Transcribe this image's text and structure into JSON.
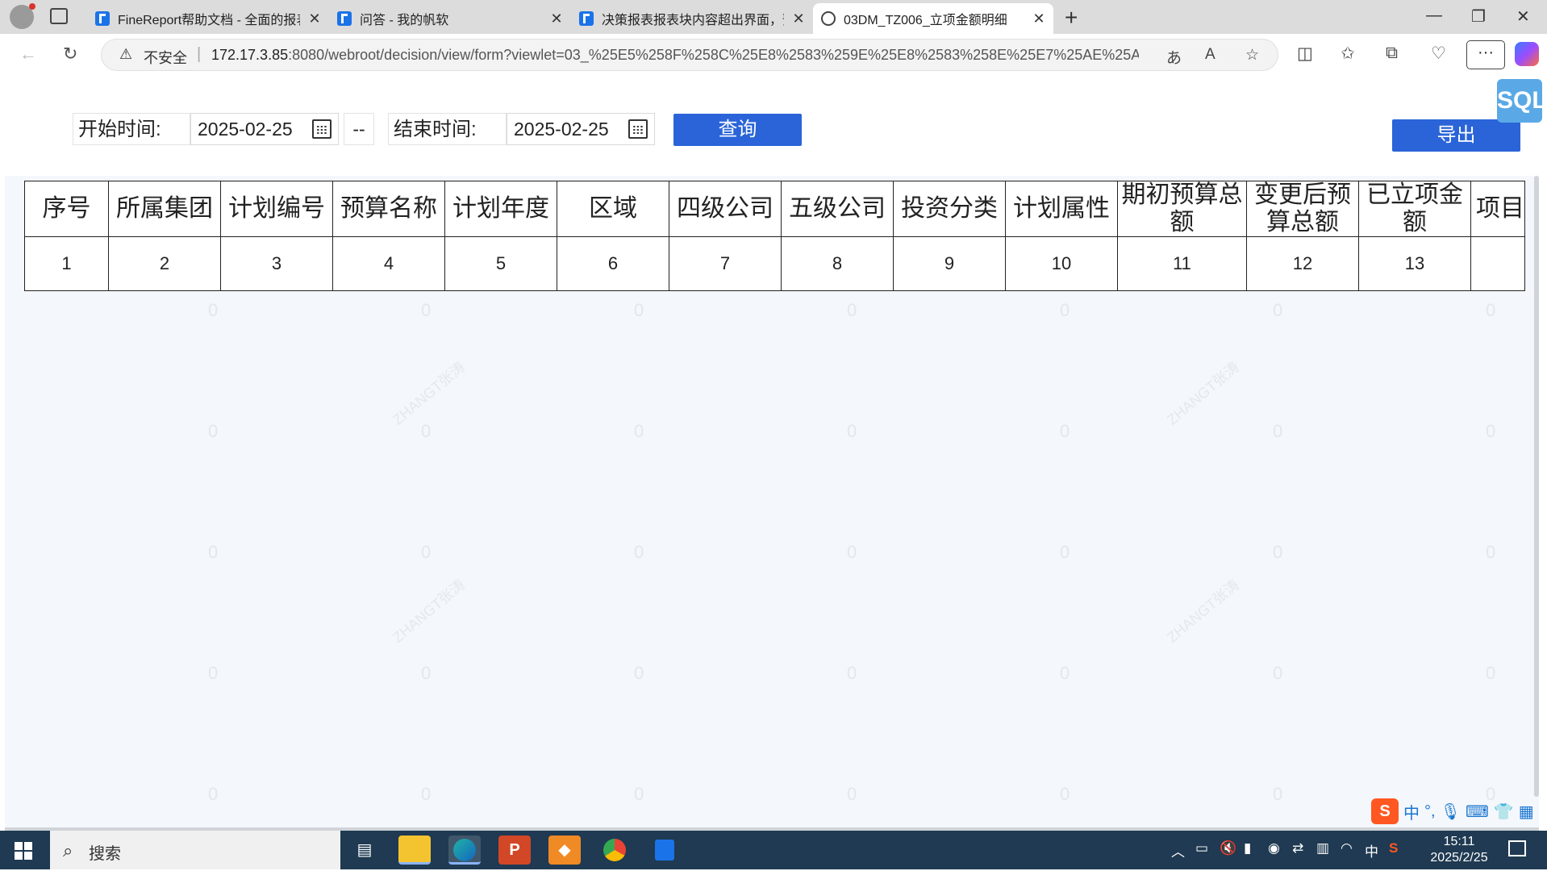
{
  "browser": {
    "tabs": [
      {
        "title": "FineReport帮助文档 - 全面的报表",
        "active": false
      },
      {
        "title": "问答 - 我的帆软",
        "active": false
      },
      {
        "title": "决策报表报表块内容超出界面，预",
        "active": false
      },
      {
        "title": "03DM_TZ006_立项金额明细",
        "active": true
      }
    ],
    "insecure_label": "不安全",
    "url_host": "172.17.3.85",
    "url_rest": ":8080/webroot/decision/view/form?viewlet=03_%25E5%258F%258C%25E8%2583%259E%25E8%2583%258E%25E7%25AE%25A1%25E7%...",
    "new_tab": "+",
    "more": "···"
  },
  "filters": {
    "start_label": "开始时间:",
    "start_value": "2025-02-25",
    "separator": "--",
    "end_label": "结束时间:",
    "end_value": "2025-02-25",
    "query_button": "查询",
    "export_button": "导出"
  },
  "table": {
    "headers": [
      "序号",
      "所属集团",
      "计划编号",
      "预算名称",
      "计划年度",
      "区域",
      "四级公司",
      "五级公司",
      "投资分类",
      "计划属性",
      "期初预算总额",
      "变更后预算总额",
      "已立项金额",
      "项目"
    ],
    "row": [
      "1",
      "2",
      "3",
      "4",
      "5",
      "6",
      "7",
      "8",
      "9",
      "10",
      "11",
      "12",
      "13",
      ""
    ]
  },
  "watermark": {
    "digit": "0",
    "text": "ZHANGT张涛"
  },
  "sql_badge": "SQL",
  "ime": {
    "mode": "中",
    "punct": "°,"
  },
  "taskbar": {
    "search_placeholder": "搜索",
    "tray_lang": "中",
    "time": "15:11",
    "date": "2025/2/25"
  }
}
